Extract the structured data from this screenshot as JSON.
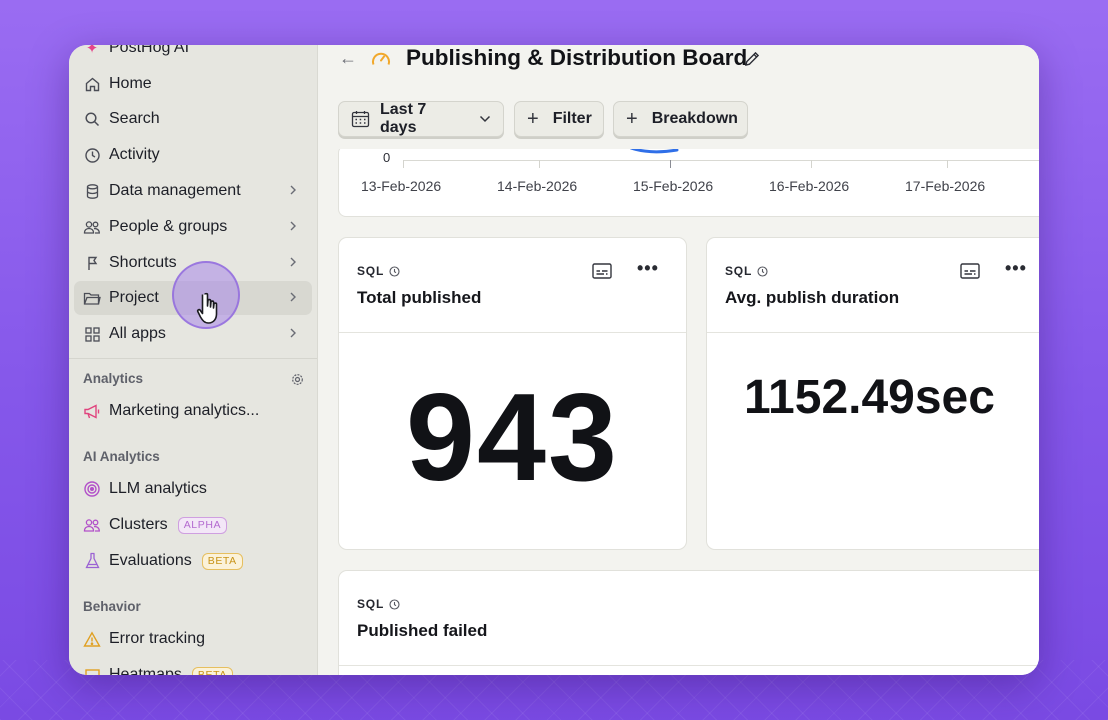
{
  "sidebar": {
    "top_item": "PostHog AI",
    "items": [
      {
        "label": "Home",
        "icon": "home-icon"
      },
      {
        "label": "Search",
        "icon": "search-icon"
      },
      {
        "label": "Activity",
        "icon": "clock-icon"
      },
      {
        "label": "Data management",
        "icon": "database-icon"
      },
      {
        "label": "People & groups",
        "icon": "people-icon"
      },
      {
        "label": "Shortcuts",
        "icon": "shortcut-icon"
      },
      {
        "label": "Project",
        "icon": "folder-icon"
      },
      {
        "label": "All apps",
        "icon": "apps-icon"
      }
    ],
    "sections": {
      "analytics": {
        "title": "Analytics",
        "items": [
          {
            "label": "Marketing analytics...",
            "icon": "megaphone-icon"
          }
        ]
      },
      "ai_analytics": {
        "title": "AI Analytics",
        "items": [
          {
            "label": "LLM analytics",
            "icon": "llm-icon"
          },
          {
            "label": "Clusters",
            "icon": "clusters-icon",
            "badge": "ALPHA"
          },
          {
            "label": "Evaluations",
            "icon": "flask-icon",
            "badge": "BETA"
          }
        ]
      },
      "behavior": {
        "title": "Behavior",
        "items": [
          {
            "label": "Error tracking",
            "icon": "warning-icon"
          },
          {
            "label": "Heatmaps",
            "icon": "heatmap-icon",
            "badge": "BETA"
          }
        ]
      }
    }
  },
  "header": {
    "title": "Publishing & Distribution Board",
    "date_range": "Last 7 days",
    "filter_label": "Filter",
    "breakdown_label": "Breakdown"
  },
  "chart": {
    "y_zero": "0",
    "x_ticks": [
      "13-Feb-2026",
      "14-Feb-2026",
      "15-Feb-2026",
      "16-Feb-2026",
      "17-Feb-2026"
    ]
  },
  "cards": [
    {
      "kind": "SQL",
      "title": "Total published",
      "value": "943"
    },
    {
      "kind": "SQL",
      "title": "Avg. publish duration",
      "value": "1152.49sec"
    },
    {
      "kind": "SQL",
      "title": "Published failed"
    }
  ],
  "colors": {
    "accent": "#f1a82c",
    "chart_line": "#2f6fe8",
    "alpha": "#b46bd0",
    "beta": "#c89317"
  }
}
